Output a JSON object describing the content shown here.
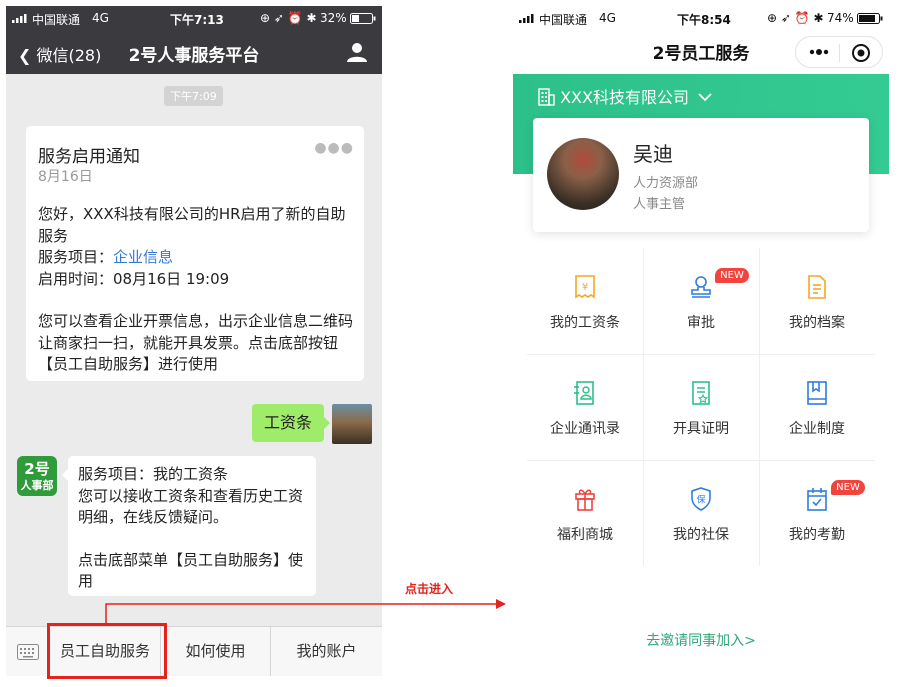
{
  "left": {
    "status": {
      "carrier": "中国联通",
      "network": "4G",
      "time": "下午7:13",
      "battery": "32%"
    },
    "nav": {
      "back": "微信(28)",
      "title": "2号人事服务平台"
    },
    "time_pill": "下午7:09",
    "card": {
      "title": "服务启用通知",
      "date": "8月16日",
      "line1": "您好，XXX科技有限公司的HR启用了新的自助服务",
      "line2_prefix": "服务项目：",
      "line2_link": "企业信息",
      "line3": "启用时间：08月16日 19:09",
      "line4": "您可以查看企业开票信息，出示企业信息二维码让商家扫一扫，就能开具发票。点击底部按钮【员工自助服务】进行使用"
    },
    "sent_message": "工资条",
    "bot_avatar": {
      "top": "2号",
      "bottom": "人事部"
    },
    "bot_message": {
      "l1": "服务项目：我的工资条",
      "l2": "您可以接收工资条和查看历史工资明细，在线反馈疑问。",
      "l3": "点击底部菜单【员工自助服务】使用"
    },
    "menu": [
      "员工自助服务",
      "如何使用",
      "我的账户"
    ]
  },
  "click_hint": "点击进入",
  "right": {
    "status": {
      "carrier": "中国联通",
      "network": "4G",
      "time": "下午8:54",
      "battery": "74%"
    },
    "title": "2号员工服务",
    "company": "XXX科技有限公司",
    "profile": {
      "name": "吴迪",
      "dept": "人力资源部",
      "role": "人事主管"
    },
    "grid": [
      {
        "label": "我的工资条",
        "icon": "payslip-icon",
        "badge": ""
      },
      {
        "label": "审批",
        "icon": "approval-icon",
        "badge": "NEW"
      },
      {
        "label": "我的档案",
        "icon": "archive-icon",
        "badge": ""
      },
      {
        "label": "企业通讯录",
        "icon": "contacts-icon",
        "badge": ""
      },
      {
        "label": "开具证明",
        "icon": "certificate-icon",
        "badge": ""
      },
      {
        "label": "企业制度",
        "icon": "policy-icon",
        "badge": ""
      },
      {
        "label": "福利商城",
        "icon": "gift-icon",
        "badge": ""
      },
      {
        "label": "我的社保",
        "icon": "insurance-icon",
        "badge": ""
      },
      {
        "label": "我的考勤",
        "icon": "attendance-icon",
        "badge": "NEW"
      }
    ],
    "invite": "去邀请同事加入>",
    "colors": {
      "brand": "#2dc08a",
      "red": "#e5221b",
      "orange": "#f5a623",
      "blue": "#2f7ce0"
    }
  }
}
